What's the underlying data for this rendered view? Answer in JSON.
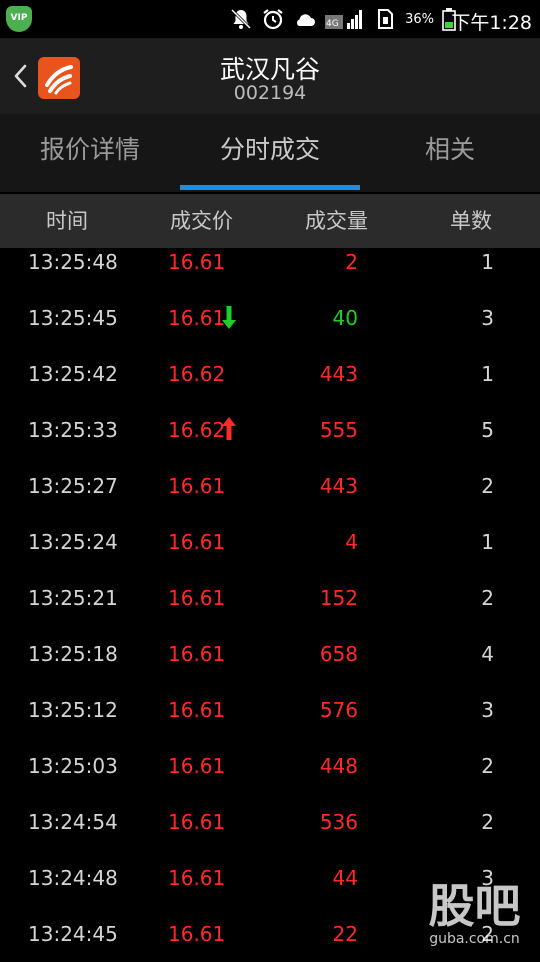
{
  "status_bar": {
    "battery_percent": "36%",
    "time": "下午1:28",
    "network": "4G"
  },
  "header": {
    "stock_name": "武汉凡谷",
    "stock_code": "002194"
  },
  "tabs": [
    {
      "label": "报价详情",
      "active": false
    },
    {
      "label": "分时成交",
      "active": true
    },
    {
      "label": "相关",
      "active": false
    }
  ],
  "columns": [
    "时间",
    "成交价",
    "成交量",
    "单数"
  ],
  "rows": [
    {
      "time": "13:25:48",
      "price": "16.61",
      "volume": "2",
      "count": "1",
      "arrow": "",
      "volume_color": "red"
    },
    {
      "time": "13:25:45",
      "price": "16.61",
      "volume": "40",
      "count": "3",
      "arrow": "down",
      "volume_color": "green"
    },
    {
      "time": "13:25:42",
      "price": "16.62",
      "volume": "443",
      "count": "1",
      "arrow": "",
      "volume_color": "red"
    },
    {
      "time": "13:25:33",
      "price": "16.62",
      "volume": "555",
      "count": "5",
      "arrow": "up",
      "volume_color": "red"
    },
    {
      "time": "13:25:27",
      "price": "16.61",
      "volume": "443",
      "count": "2",
      "arrow": "",
      "volume_color": "red"
    },
    {
      "time": "13:25:24",
      "price": "16.61",
      "volume": "4",
      "count": "1",
      "arrow": "",
      "volume_color": "red"
    },
    {
      "time": "13:25:21",
      "price": "16.61",
      "volume": "152",
      "count": "2",
      "arrow": "",
      "volume_color": "red"
    },
    {
      "time": "13:25:18",
      "price": "16.61",
      "volume": "658",
      "count": "4",
      "arrow": "",
      "volume_color": "red"
    },
    {
      "time": "13:25:12",
      "price": "16.61",
      "volume": "576",
      "count": "3",
      "arrow": "",
      "volume_color": "red"
    },
    {
      "time": "13:25:03",
      "price": "16.61",
      "volume": "448",
      "count": "2",
      "arrow": "",
      "volume_color": "red"
    },
    {
      "time": "13:24:54",
      "price": "16.61",
      "volume": "536",
      "count": "2",
      "arrow": "",
      "volume_color": "red"
    },
    {
      "time": "13:24:48",
      "price": "16.61",
      "volume": "44",
      "count": "3",
      "arrow": "",
      "volume_color": "red"
    },
    {
      "time": "13:24:45",
      "price": "16.61",
      "volume": "22",
      "count": "2",
      "arrow": "",
      "volume_color": "red"
    }
  ],
  "watermark": {
    "logo": "股吧",
    "url": "guba.com.cn"
  },
  "colors": {
    "up": "#ff2a2a",
    "down": "#1ecf2c",
    "accent": "#1a8fe3",
    "brand": "#e9531d"
  },
  "icons": {
    "vip": "VIP"
  }
}
